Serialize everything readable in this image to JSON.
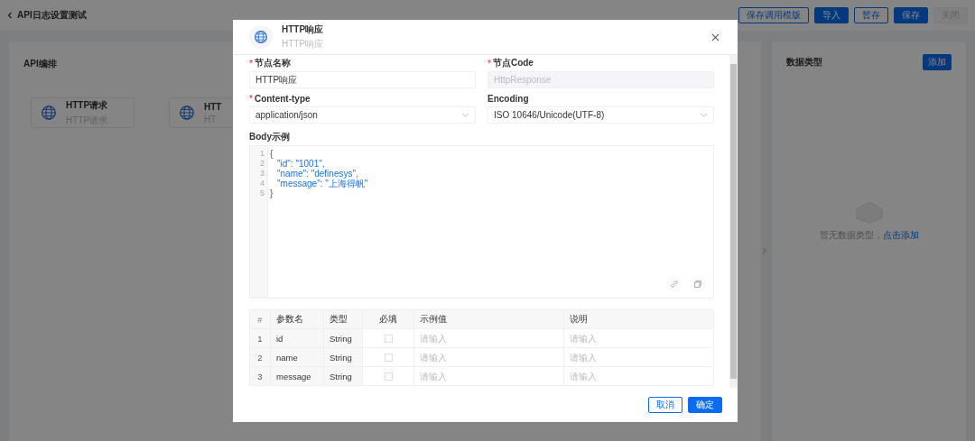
{
  "page": {
    "back_title": "API日志设置测试",
    "actions": [
      {
        "label": "保存调用模版",
        "kind": "outline"
      },
      {
        "label": "导入",
        "kind": "primary"
      },
      {
        "label": "暂存",
        "kind": "outline"
      },
      {
        "label": "保存",
        "kind": "primary"
      },
      {
        "label": "关闭",
        "kind": "plain"
      }
    ],
    "canvas": {
      "title": "API编排",
      "nodes": [
        {
          "title": "HTTP请求",
          "subtitle": "HTTP请求"
        },
        {
          "title": "HTT",
          "subtitle": "HT"
        }
      ]
    },
    "data_types": {
      "title": "数据类型",
      "add_button": "添加",
      "empty_text": "暂无数据类型，",
      "empty_link": "点击添加"
    }
  },
  "dialog": {
    "title": "HTTP响应",
    "subtitle": "HTTP响应",
    "fields": [
      {
        "label": "节点名称",
        "required_mark": "*",
        "kind": "input",
        "value": "HTTP响应",
        "disabled": false
      },
      {
        "label": "节点Code",
        "required_mark": "*",
        "kind": "input",
        "value": "HttpResponse",
        "disabled": true
      },
      {
        "label": "Content-type",
        "required_mark": "*",
        "kind": "select",
        "value": "application/json",
        "disabled": false
      },
      {
        "label": "Encoding",
        "kind": "select",
        "value": "ISO 10646/Unicode(UTF-8)",
        "disabled": false
      }
    ],
    "body_label": "Body示例",
    "code_lines": [
      {
        "number": "1",
        "text": "{",
        "kind": "brace"
      },
      {
        "number": "2",
        "text": "\"id\": \"1001\",",
        "kind": "pair"
      },
      {
        "number": "3",
        "text": "\"name\": \"definesys\",",
        "kind": "pair"
      },
      {
        "number": "4",
        "text": "\"message\": \"上海得帆\"",
        "kind": "pair"
      },
      {
        "number": "5",
        "text": "}",
        "kind": "brace"
      }
    ],
    "table": {
      "columns": [
        "#",
        "参数名",
        "类型",
        "必填",
        "示例值",
        "说明"
      ],
      "rows": [
        {
          "index": "1",
          "name": "id",
          "type": "String",
          "required": false,
          "example_placeholder": "请输入",
          "description_placeholder": "请输入"
        },
        {
          "index": "2",
          "name": "name",
          "type": "String",
          "required": false,
          "example_placeholder": "请输入",
          "description_placeholder": "请输入"
        },
        {
          "index": "3",
          "name": "message",
          "type": "String",
          "required": false,
          "example_placeholder": "请输入",
          "description_placeholder": "请输入"
        }
      ]
    },
    "buttons": [
      {
        "label": "取消",
        "kind": "outline"
      },
      {
        "label": "确定",
        "kind": "primary"
      }
    ]
  }
}
